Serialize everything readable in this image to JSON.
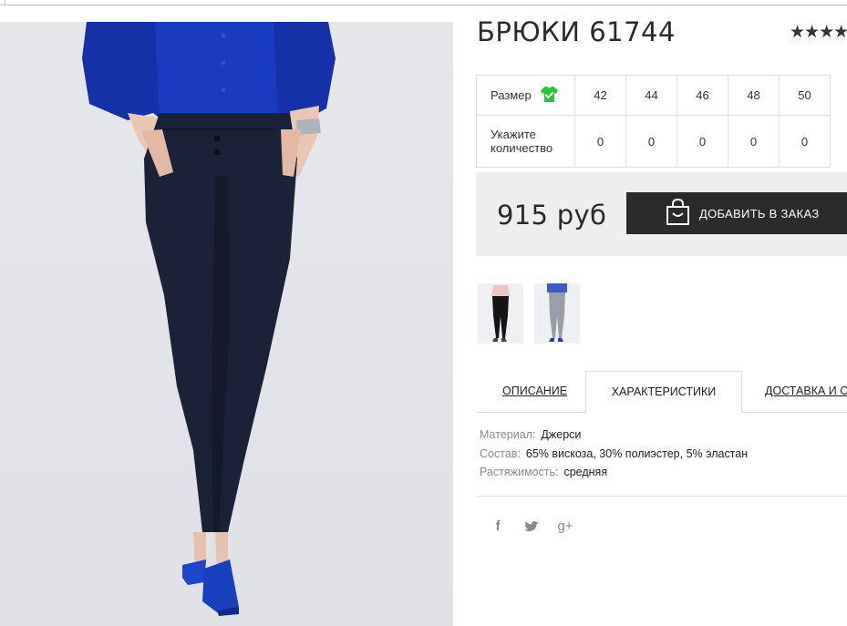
{
  "product": {
    "title": "БРЮКИ 61744",
    "rating_stars": "★★★★"
  },
  "sizes": {
    "size_label": "Размер",
    "qty_label": "Укажите количество",
    "options": [
      "42",
      "44",
      "46",
      "48",
      "50"
    ],
    "quantities": [
      "0",
      "0",
      "0",
      "0",
      "0"
    ]
  },
  "price": {
    "amount": "915 руб",
    "add_button_label": "ДОБАВИТЬ В ЗАКАЗ"
  },
  "tabs": {
    "description": "ОПИСАНИЕ",
    "characteristics": "ХАРАКТЕРИСТИКИ",
    "delivery": "ДОСТАВКА И ОП"
  },
  "specs": [
    {
      "key": "Материал:",
      "value": "Джерси"
    },
    {
      "key": "Состав:",
      "value": "65% вискоза, 30% полиэстер, 5% эластан"
    },
    {
      "key": "Растяжимость:",
      "value": "средняя"
    }
  ],
  "share": {
    "facebook": "f",
    "twitter": "t",
    "googleplus": "g+"
  },
  "colors": {
    "button_bg": "#2b2b2b",
    "price_bg": "#eeeeee",
    "size_icon": "#27c43c",
    "pants": "#1b2238",
    "blouse": "#1631a8"
  }
}
